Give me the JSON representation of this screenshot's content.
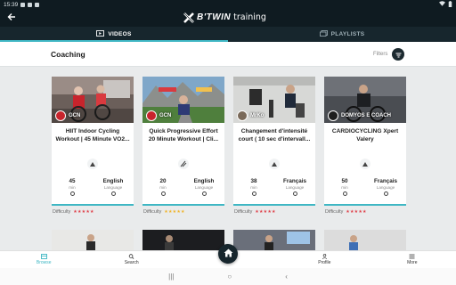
{
  "status_bar": {
    "time": "15:39"
  },
  "header": {
    "brand_prefix": "B'TWIN",
    "brand_suffix": "training"
  },
  "tabs": [
    {
      "label": "VIDEOS",
      "icon": "play-icon",
      "active": true
    },
    {
      "label": "PLAYLISTS",
      "icon": "playlist-icon",
      "active": false
    }
  ],
  "section": {
    "title": "Coaching",
    "filters_label": "Filters"
  },
  "cards": [
    {
      "channel": "GCN",
      "title": "HIIT Indoor Cycling Workout | 45 Minute VO2...",
      "duration": "45",
      "duration_unit": "min",
      "language": "English",
      "language_label": "Language",
      "difficulty_label": "Difficulty",
      "difficulty_stars": "★★★★★",
      "difficulty_color": "#e0424b",
      "accent": "#3fb7c4"
    },
    {
      "channel": "GCN",
      "title": "Quick Progressive Effort 20 Minute Workout | Cli...",
      "duration": "20",
      "duration_unit": "min",
      "language": "English",
      "language_label": "Language",
      "difficulty_label": "Difficulty",
      "difficulty_stars": "★★★★★",
      "difficulty_color": "#f0b429",
      "accent": "#3fb7c4"
    },
    {
      "channel": "MrKo",
      "title": "Changement d'intensité court ( 10 sec d'intervall...",
      "duration": "38",
      "duration_unit": "min",
      "language": "Français",
      "language_label": "Language",
      "difficulty_label": "Difficulty",
      "difficulty_stars": "★★★★★",
      "difficulty_color": "#e0424b",
      "accent": "#3fb7c4"
    },
    {
      "channel": "DOMYOS E COACH",
      "title": "CARDIOCYCLING Xpert Valery",
      "duration": "50",
      "duration_unit": "min",
      "language": "Français",
      "language_label": "Language",
      "difficulty_label": "Difficulty",
      "difficulty_stars": "★★★★★",
      "difficulty_color": "#e0424b",
      "accent": "#3fb7c4"
    }
  ],
  "bottom_nav": [
    {
      "label": "Browse",
      "icon": "browse-icon",
      "active": true
    },
    {
      "label": "Search",
      "icon": "search-icon",
      "active": false
    },
    {
      "label": "Profile",
      "icon": "profile-icon",
      "active": false
    },
    {
      "label": "More",
      "icon": "menu-icon",
      "active": false
    }
  ],
  "home_button": {
    "icon": "home-icon"
  },
  "system_nav": {
    "recents_glyph": "|||",
    "home_glyph": "○",
    "back_glyph": "‹"
  }
}
